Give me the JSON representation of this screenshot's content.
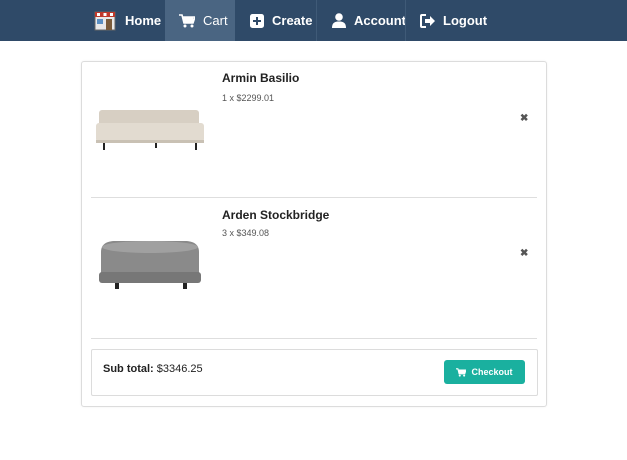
{
  "nav": {
    "items": [
      {
        "label": "Home",
        "icon": "store-icon"
      },
      {
        "label": "Cart",
        "icon": "cart-icon",
        "active": true
      },
      {
        "label": "Create",
        "icon": "plus-square-icon"
      },
      {
        "label": "Account",
        "icon": "user-icon"
      },
      {
        "label": "Logout",
        "icon": "sign-out-icon"
      }
    ]
  },
  "cart": {
    "items": [
      {
        "name": "Armin Basilio",
        "qty_price": "1 x $2299.01",
        "image": "sofa-image"
      },
      {
        "name": "Arden Stockbridge",
        "qty_price": "3 x $349.08",
        "image": "ottoman-image"
      }
    ],
    "remove_symbol": "✖",
    "subtotal_label": "Sub total:",
    "subtotal_value": "$3346.25",
    "checkout_label": "Checkout"
  },
  "colors": {
    "navbar": "#2f4a68",
    "nav_active": "#4a6582",
    "checkout": "#1ab09f"
  }
}
